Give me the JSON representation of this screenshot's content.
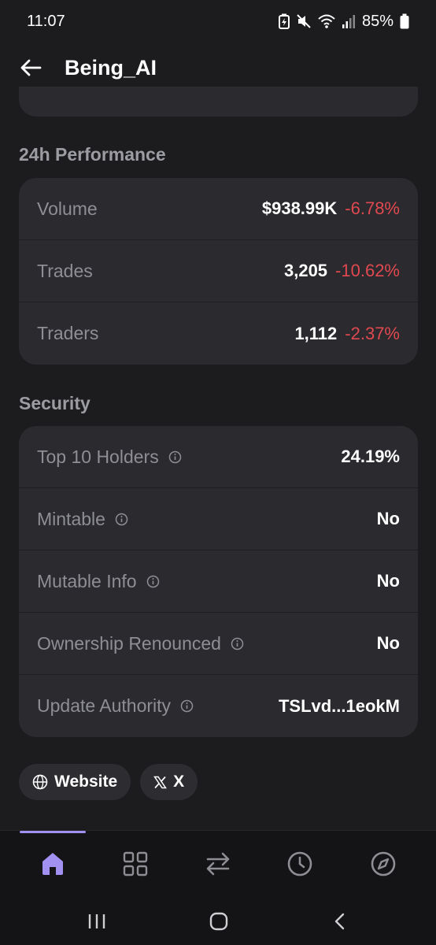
{
  "status": {
    "time": "11:07",
    "battery": "85%"
  },
  "header": {
    "title": "Being_AI"
  },
  "performance": {
    "title": "24h Performance",
    "rows": [
      {
        "label": "Volume",
        "value": "$938.99K",
        "change": "-6.78%"
      },
      {
        "label": "Trades",
        "value": "3,205",
        "change": "-10.62%"
      },
      {
        "label": "Traders",
        "value": "1,112",
        "change": "-2.37%"
      }
    ]
  },
  "security": {
    "title": "Security",
    "rows": [
      {
        "label": "Top 10 Holders",
        "value": "24.19%"
      },
      {
        "label": "Mintable",
        "value": "No"
      },
      {
        "label": "Mutable Info",
        "value": "No"
      },
      {
        "label": "Ownership Renounced",
        "value": "No"
      },
      {
        "label": "Update Authority",
        "value": "TSLvd...1eokM"
      }
    ]
  },
  "links": {
    "website": "Website",
    "x": "X"
  },
  "tabs": [
    "home-icon",
    "grid-icon",
    "swap-icon",
    "history-icon",
    "compass-icon"
  ],
  "colors": {
    "background": "#1c1c1f",
    "card": "#2a2a2f",
    "negative": "#e0494f",
    "accent": "#a391f2"
  }
}
